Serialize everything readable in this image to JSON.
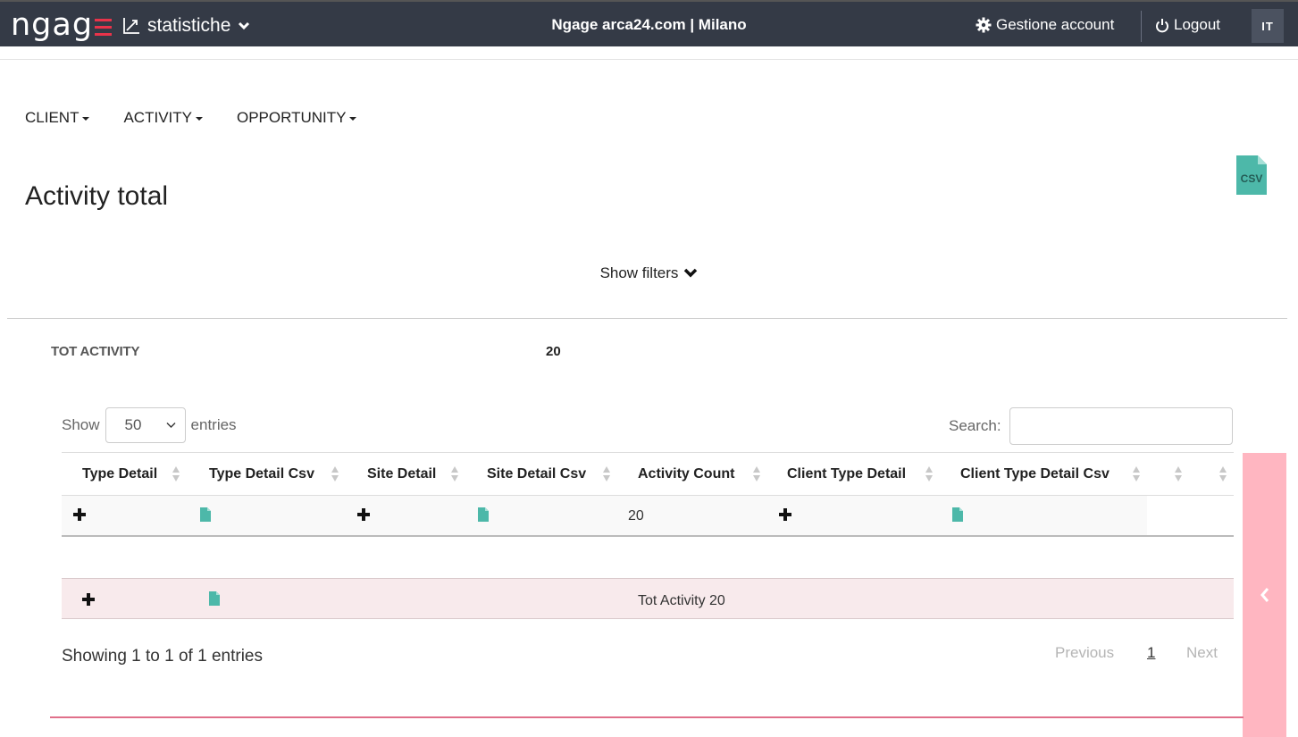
{
  "header": {
    "logo": "ngag",
    "section": "statistiche",
    "title": "Ngage arca24.com | Milano",
    "account_label": "Gestione account",
    "logout_label": "Logout",
    "language": "IT"
  },
  "menu": {
    "items": [
      {
        "label": "CLIENT"
      },
      {
        "label": "ACTIVITY"
      },
      {
        "label": "OPPORTUNITY"
      }
    ]
  },
  "page": {
    "title": "Activity total",
    "csv_label": "CSV",
    "show_filters": "Show filters"
  },
  "summary": {
    "label": "TOT ACTIVITY",
    "value": "20"
  },
  "table_controls": {
    "show_label": "Show",
    "entries_value": "50",
    "entries_label": "entries",
    "search_label": "Search:"
  },
  "table": {
    "columns": [
      "Type Detail",
      "Type Detail Csv",
      "Site Detail",
      "Site Detail Csv",
      "Activity Count",
      "Client Type Detail",
      "Client Type Detail Csv"
    ],
    "row": {
      "activity_count": "20"
    },
    "footer_text": "Tot Activity 20"
  },
  "pagination": {
    "info": "Showing 1 to 1 of 1 entries",
    "previous": "Previous",
    "page": "1",
    "next": "Next"
  },
  "colors": {
    "topbar": "#343a46",
    "accent": "#e8334a",
    "csv": "#4db8a9",
    "side_panel": "#ffb6c1",
    "footer_row": "#f8eaec"
  }
}
